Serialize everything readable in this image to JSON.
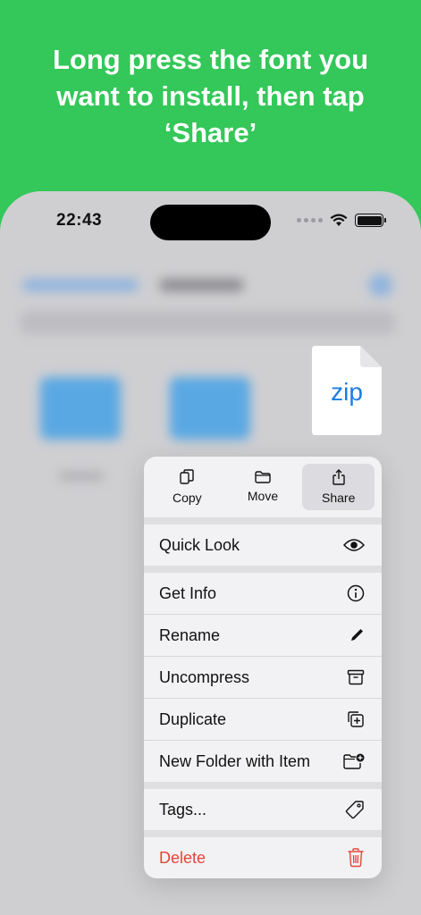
{
  "headline": "Long press the font you\nwant to install, then tap\n‘Share’",
  "status_bar": {
    "time": "22:43"
  },
  "file": {
    "label": "zip"
  },
  "quick_actions": [
    {
      "label": "Copy",
      "icon": "copy-icon"
    },
    {
      "label": "Move",
      "icon": "folder-icon"
    },
    {
      "label": "Share",
      "icon": "share-icon",
      "selected": true
    }
  ],
  "menu": {
    "quick_look": "Quick Look",
    "get_info": "Get Info",
    "rename": "Rename",
    "uncompress": "Uncompress",
    "duplicate": "Duplicate",
    "new_folder_with_item": "New Folder with Item",
    "tags": "Tags...",
    "delete": "Delete"
  },
  "colors": {
    "background": "#34c759",
    "accent": "#1a7ee0",
    "destructive": "#e5443a"
  }
}
